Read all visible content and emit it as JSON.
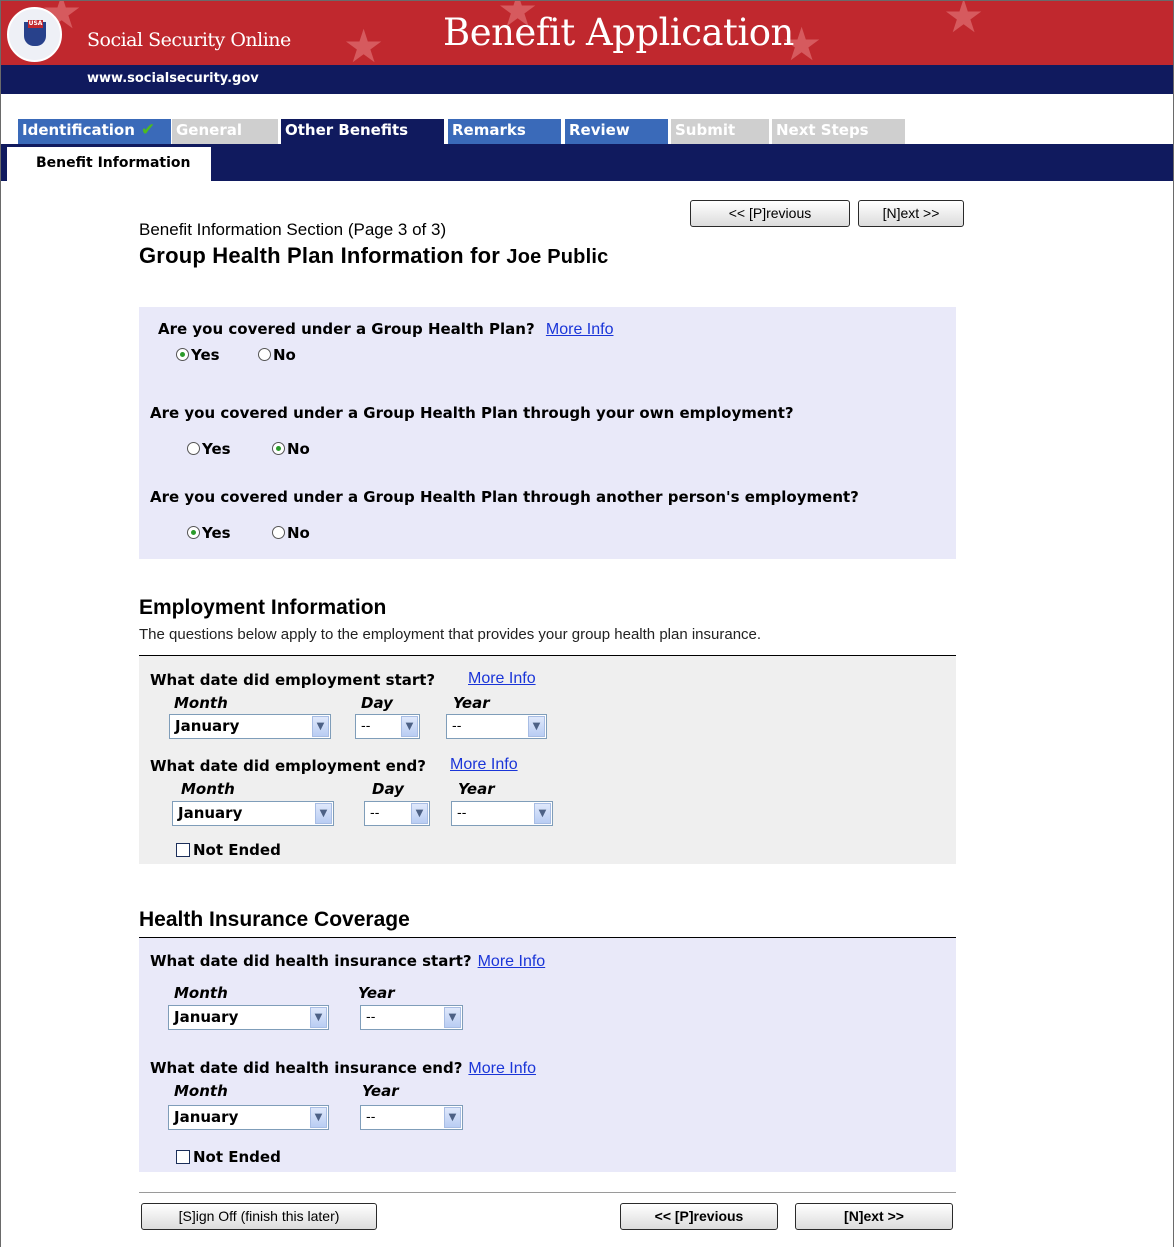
{
  "header": {
    "brand": "Social Security Online",
    "title": "Benefit Application",
    "url": "www.socialsecurity.gov",
    "seal_text": "USA"
  },
  "tabs": [
    {
      "label": "Identification",
      "state": "completed"
    },
    {
      "label": "General",
      "state": "disabled"
    },
    {
      "label": "Other Benefits",
      "state": "current"
    },
    {
      "label": "Remarks",
      "state": "available"
    },
    {
      "label": "Review",
      "state": "available"
    },
    {
      "label": "Submit",
      "state": "disabled"
    },
    {
      "label": "Next Steps",
      "state": "disabled"
    }
  ],
  "subtab": "Benefit Information",
  "nav": {
    "previous": "<< [P]revious",
    "next": "[N]ext >>",
    "sign_off": "[S]ign Off (finish this later)"
  },
  "page": {
    "section": "Benefit Information Section (Page 3 of 3)",
    "title": "Group Health Plan Information for",
    "name": "Joe Public"
  },
  "group_plan": {
    "q1": "Are you covered under a Group Health Plan?",
    "q1_answer": "Yes",
    "q2": "Are you covered under a Group Health Plan through your own employment?",
    "q2_answer": "No",
    "q3": "Are you covered under a Group Health Plan through another person's employment?",
    "q3_answer": "Yes",
    "yes": "Yes",
    "no": "No",
    "more_info": "More Info"
  },
  "employment": {
    "heading": "Employment Information",
    "intro": "The questions below apply to the employment that provides your group health plan insurance.",
    "start_q": "What date did employment start?",
    "end_q": "What date did employment end?",
    "month_label": "Month",
    "day_label": "Day",
    "year_label": "Year",
    "month_value": "January",
    "day_value": "--",
    "year_value": "--",
    "not_ended": "Not Ended"
  },
  "coverage": {
    "heading": "Health Insurance Coverage",
    "start_q": "What date did health insurance start?",
    "end_q": "What date did health insurance end?",
    "month_label": "Month",
    "year_label": "Year",
    "month_value": "January",
    "year_value": "--",
    "not_ended": "Not Ended"
  },
  "colors": {
    "header_red": "#c0282e",
    "navy": "#101a5e",
    "tab_blue": "#3a6ab9",
    "panel_lavender": "#e9e9f9",
    "panel_gray": "#efefef",
    "link": "#1a35d8"
  }
}
